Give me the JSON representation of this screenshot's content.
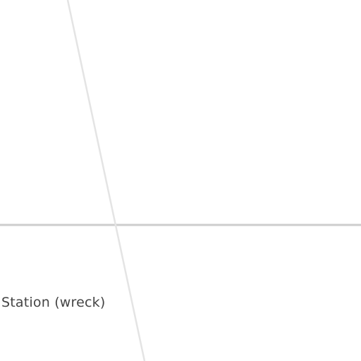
{
  "map": {
    "labels": {
      "station": "Station (wreck)"
    },
    "colors": {
      "background": "#ffffff",
      "minor_road": "#e4e4e4",
      "horizontal_road": "#cdcdcd",
      "label_text": "#444444"
    },
    "features": [
      {
        "type": "road",
        "kind": "minor"
      },
      {
        "type": "road",
        "kind": "horizontal-line"
      },
      {
        "type": "poi",
        "kind": "station-wreck"
      }
    ]
  }
}
